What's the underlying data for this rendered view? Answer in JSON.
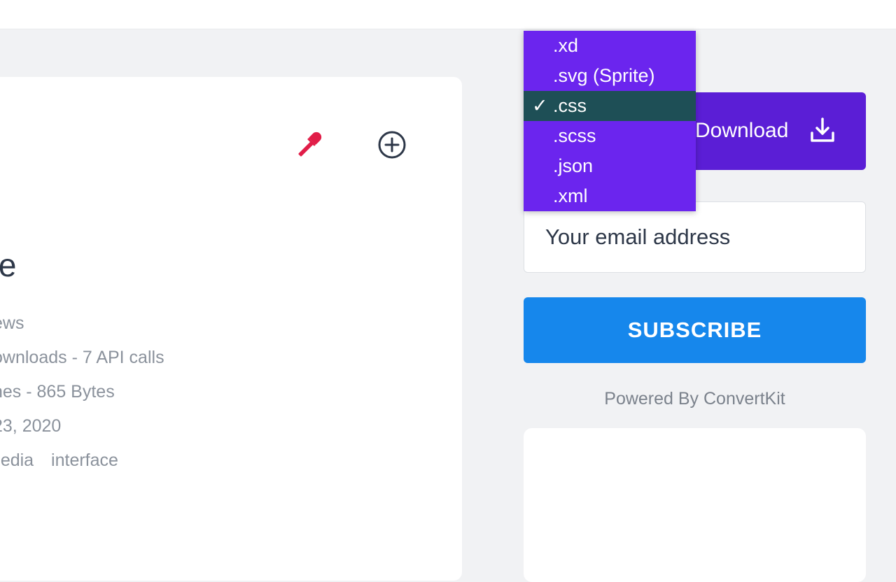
{
  "card": {
    "title": "me",
    "meta": [
      "ews",
      "ownloads - 7 API calls",
      "nes - 865 Bytes",
      "23, 2020"
    ],
    "tags": [
      "media",
      "interface"
    ]
  },
  "icons": {
    "picker": "color-picker-icon",
    "add": "add-circle-icon",
    "download": "download-icon"
  },
  "download": {
    "label": "Download"
  },
  "dropdown": {
    "items": [
      ".xd",
      ".svg (Sprite)",
      ".css",
      ".scss",
      ".json",
      ".xml"
    ],
    "selected": ".css",
    "check": "✓"
  },
  "newsletter": {
    "email_placeholder": "Your email address",
    "subscribe_label": "SUBSCRIBE",
    "powered_by": "Powered By ConvertKit"
  },
  "colors": {
    "picker_icon": "#e11d48",
    "download_button": "#5b1ed6",
    "dropdown_bg": "#6b25ee",
    "dropdown_selected": "#1e4f56",
    "subscribe_button": "#1687ec"
  }
}
